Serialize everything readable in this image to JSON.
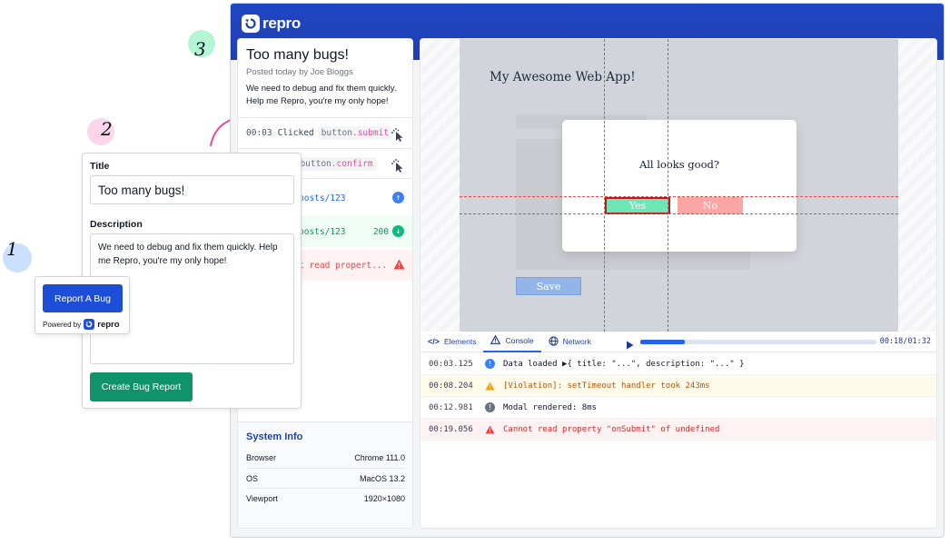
{
  "steps": {
    "one": "1",
    "two": "2",
    "three": "3"
  },
  "colors": {
    "brand": "#1e40af",
    "create_button": "#0e9468",
    "report_button": "#1d4ed8",
    "yes_button": "#6ee7b7",
    "no_button": "#fca5a5",
    "error": "#ef4444",
    "warning": "#f59e0b",
    "info": "#3b82f6"
  },
  "app": {
    "brand": "repro",
    "bug": {
      "title": "Too many bugs!",
      "meta": "Posted today by Joe Bloggs",
      "description": "We need to debug and fix them quickly. Help me Repro, you're my only hope!"
    },
    "events": [
      {
        "time": "00:03",
        "action": "Clicked",
        "tag_prefix": "button",
        "tag_suffix": ".submit",
        "icon": "cursor-click-icon"
      },
      {
        "time": "",
        "action": "ed",
        "tag_prefix": "button",
        "tag_suffix": ".confirm",
        "icon": "cursor-click-icon"
      },
      {
        "text": "posts/123",
        "icon": "arrow-up-icon"
      },
      {
        "text": "posts/123",
        "status": "200",
        "icon": "arrow-down-icon"
      },
      {
        "text": "t read propert...",
        "icon": "warning-icon"
      }
    ],
    "system_info": {
      "title": "System Info",
      "rows": [
        {
          "label": "Browser",
          "value": "Chrome 111.0"
        },
        {
          "label": "OS",
          "value": "MacOS 13.2"
        },
        {
          "label": "Viewport",
          "value": "1920×1080"
        }
      ]
    },
    "replay": {
      "heading": "My Awesome Web App!",
      "modal_question": "All looks good?",
      "yes_label": "Yes",
      "no_label": "No",
      "save_label": "Save"
    },
    "devtools": {
      "tabs": [
        {
          "label": "Elements",
          "icon": "code-icon"
        },
        {
          "label": "Console",
          "icon": "warning-triangle-icon"
        },
        {
          "label": "Network",
          "icon": "globe-icon"
        }
      ],
      "active_tab": "Console",
      "playback_time": "00:18/01:32",
      "playback_progress": 0.19,
      "logs": [
        {
          "time": "00:03.125",
          "level": "info",
          "message": "Data loaded  ▶{ title: \"...\", description: \"...\" }"
        },
        {
          "time": "00:08.204",
          "level": "warning",
          "message": "[Violation]: setTimeout handler took 243ms"
        },
        {
          "time": "00:12.981",
          "level": "info",
          "message": "Modal rendered: 8ms"
        },
        {
          "time": "00:19.056",
          "level": "error",
          "message": "Cannot read property \"onSubmit\" of undefined"
        }
      ]
    }
  },
  "form": {
    "title_label": "Title",
    "title_value": "Too many bugs!",
    "description_label": "Description",
    "description_value": "We need to debug and fix them quickly. Help me Repro, you're my only hope!",
    "create_label": "Create Bug Report"
  },
  "widget": {
    "report_label": "Report A Bug",
    "powered_label": "Powered by",
    "brand": "repro"
  }
}
